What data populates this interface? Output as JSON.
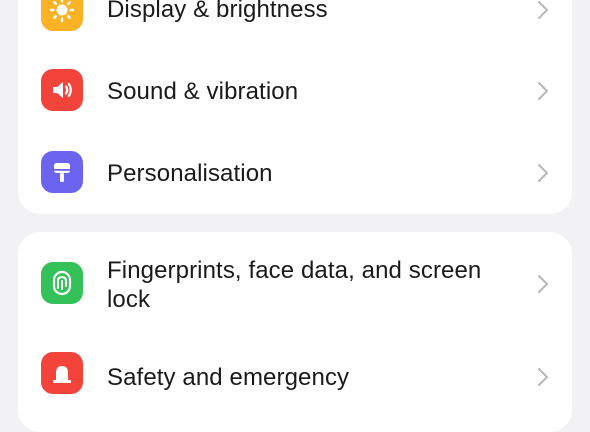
{
  "groups": [
    {
      "items": [
        {
          "label": "Display & brightness",
          "icon": "sun-icon",
          "color": "#fbb325"
        },
        {
          "label": "Sound & vibration",
          "icon": "speaker-icon",
          "color": "#f2443a"
        },
        {
          "label": "Personalisation",
          "icon": "paintbrush-icon",
          "color": "#6c63f0"
        }
      ]
    },
    {
      "items": [
        {
          "label": "Fingerprints, face data, and screen lock",
          "icon": "fingerprint-icon",
          "color": "#35c159"
        },
        {
          "label": "Safety and emergency",
          "icon": "emergency-icon",
          "color": "#f2443a"
        }
      ]
    }
  ]
}
